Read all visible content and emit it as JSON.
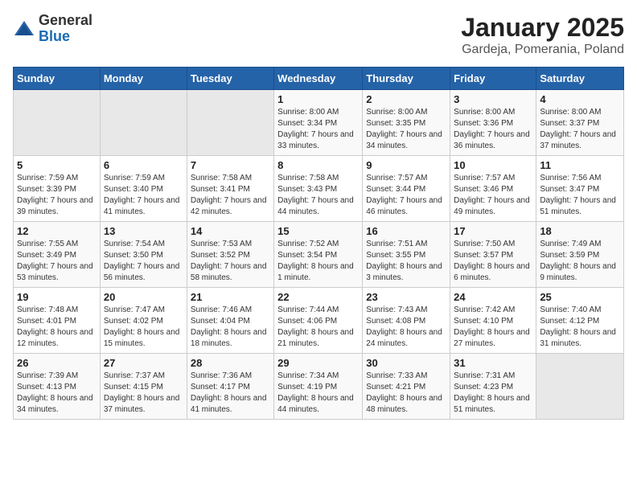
{
  "logo": {
    "text_general": "General",
    "text_blue": "Blue"
  },
  "header": {
    "title": "January 2025",
    "subtitle": "Gardeja, Pomerania, Poland"
  },
  "days_of_week": [
    "Sunday",
    "Monday",
    "Tuesday",
    "Wednesday",
    "Thursday",
    "Friday",
    "Saturday"
  ],
  "weeks": [
    [
      {
        "day": "",
        "sunrise": "",
        "sunset": "",
        "daylight": ""
      },
      {
        "day": "",
        "sunrise": "",
        "sunset": "",
        "daylight": ""
      },
      {
        "day": "",
        "sunrise": "",
        "sunset": "",
        "daylight": ""
      },
      {
        "day": "1",
        "sunrise": "Sunrise: 8:00 AM",
        "sunset": "Sunset: 3:34 PM",
        "daylight": "Daylight: 7 hours and 33 minutes."
      },
      {
        "day": "2",
        "sunrise": "Sunrise: 8:00 AM",
        "sunset": "Sunset: 3:35 PM",
        "daylight": "Daylight: 7 hours and 34 minutes."
      },
      {
        "day": "3",
        "sunrise": "Sunrise: 8:00 AM",
        "sunset": "Sunset: 3:36 PM",
        "daylight": "Daylight: 7 hours and 36 minutes."
      },
      {
        "day": "4",
        "sunrise": "Sunrise: 8:00 AM",
        "sunset": "Sunset: 3:37 PM",
        "daylight": "Daylight: 7 hours and 37 minutes."
      }
    ],
    [
      {
        "day": "5",
        "sunrise": "Sunrise: 7:59 AM",
        "sunset": "Sunset: 3:39 PM",
        "daylight": "Daylight: 7 hours and 39 minutes."
      },
      {
        "day": "6",
        "sunrise": "Sunrise: 7:59 AM",
        "sunset": "Sunset: 3:40 PM",
        "daylight": "Daylight: 7 hours and 41 minutes."
      },
      {
        "day": "7",
        "sunrise": "Sunrise: 7:58 AM",
        "sunset": "Sunset: 3:41 PM",
        "daylight": "Daylight: 7 hours and 42 minutes."
      },
      {
        "day": "8",
        "sunrise": "Sunrise: 7:58 AM",
        "sunset": "Sunset: 3:43 PM",
        "daylight": "Daylight: 7 hours and 44 minutes."
      },
      {
        "day": "9",
        "sunrise": "Sunrise: 7:57 AM",
        "sunset": "Sunset: 3:44 PM",
        "daylight": "Daylight: 7 hours and 46 minutes."
      },
      {
        "day": "10",
        "sunrise": "Sunrise: 7:57 AM",
        "sunset": "Sunset: 3:46 PM",
        "daylight": "Daylight: 7 hours and 49 minutes."
      },
      {
        "day": "11",
        "sunrise": "Sunrise: 7:56 AM",
        "sunset": "Sunset: 3:47 PM",
        "daylight": "Daylight: 7 hours and 51 minutes."
      }
    ],
    [
      {
        "day": "12",
        "sunrise": "Sunrise: 7:55 AM",
        "sunset": "Sunset: 3:49 PM",
        "daylight": "Daylight: 7 hours and 53 minutes."
      },
      {
        "day": "13",
        "sunrise": "Sunrise: 7:54 AM",
        "sunset": "Sunset: 3:50 PM",
        "daylight": "Daylight: 7 hours and 56 minutes."
      },
      {
        "day": "14",
        "sunrise": "Sunrise: 7:53 AM",
        "sunset": "Sunset: 3:52 PM",
        "daylight": "Daylight: 7 hours and 58 minutes."
      },
      {
        "day": "15",
        "sunrise": "Sunrise: 7:52 AM",
        "sunset": "Sunset: 3:54 PM",
        "daylight": "Daylight: 8 hours and 1 minute."
      },
      {
        "day": "16",
        "sunrise": "Sunrise: 7:51 AM",
        "sunset": "Sunset: 3:55 PM",
        "daylight": "Daylight: 8 hours and 3 minutes."
      },
      {
        "day": "17",
        "sunrise": "Sunrise: 7:50 AM",
        "sunset": "Sunset: 3:57 PM",
        "daylight": "Daylight: 8 hours and 6 minutes."
      },
      {
        "day": "18",
        "sunrise": "Sunrise: 7:49 AM",
        "sunset": "Sunset: 3:59 PM",
        "daylight": "Daylight: 8 hours and 9 minutes."
      }
    ],
    [
      {
        "day": "19",
        "sunrise": "Sunrise: 7:48 AM",
        "sunset": "Sunset: 4:01 PM",
        "daylight": "Daylight: 8 hours and 12 minutes."
      },
      {
        "day": "20",
        "sunrise": "Sunrise: 7:47 AM",
        "sunset": "Sunset: 4:02 PM",
        "daylight": "Daylight: 8 hours and 15 minutes."
      },
      {
        "day": "21",
        "sunrise": "Sunrise: 7:46 AM",
        "sunset": "Sunset: 4:04 PM",
        "daylight": "Daylight: 8 hours and 18 minutes."
      },
      {
        "day": "22",
        "sunrise": "Sunrise: 7:44 AM",
        "sunset": "Sunset: 4:06 PM",
        "daylight": "Daylight: 8 hours and 21 minutes."
      },
      {
        "day": "23",
        "sunrise": "Sunrise: 7:43 AM",
        "sunset": "Sunset: 4:08 PM",
        "daylight": "Daylight: 8 hours and 24 minutes."
      },
      {
        "day": "24",
        "sunrise": "Sunrise: 7:42 AM",
        "sunset": "Sunset: 4:10 PM",
        "daylight": "Daylight: 8 hours and 27 minutes."
      },
      {
        "day": "25",
        "sunrise": "Sunrise: 7:40 AM",
        "sunset": "Sunset: 4:12 PM",
        "daylight": "Daylight: 8 hours and 31 minutes."
      }
    ],
    [
      {
        "day": "26",
        "sunrise": "Sunrise: 7:39 AM",
        "sunset": "Sunset: 4:13 PM",
        "daylight": "Daylight: 8 hours and 34 minutes."
      },
      {
        "day": "27",
        "sunrise": "Sunrise: 7:37 AM",
        "sunset": "Sunset: 4:15 PM",
        "daylight": "Daylight: 8 hours and 37 minutes."
      },
      {
        "day": "28",
        "sunrise": "Sunrise: 7:36 AM",
        "sunset": "Sunset: 4:17 PM",
        "daylight": "Daylight: 8 hours and 41 minutes."
      },
      {
        "day": "29",
        "sunrise": "Sunrise: 7:34 AM",
        "sunset": "Sunset: 4:19 PM",
        "daylight": "Daylight: 8 hours and 44 minutes."
      },
      {
        "day": "30",
        "sunrise": "Sunrise: 7:33 AM",
        "sunset": "Sunset: 4:21 PM",
        "daylight": "Daylight: 8 hours and 48 minutes."
      },
      {
        "day": "31",
        "sunrise": "Sunrise: 7:31 AM",
        "sunset": "Sunset: 4:23 PM",
        "daylight": "Daylight: 8 hours and 51 minutes."
      },
      {
        "day": "",
        "sunrise": "",
        "sunset": "",
        "daylight": ""
      }
    ]
  ]
}
